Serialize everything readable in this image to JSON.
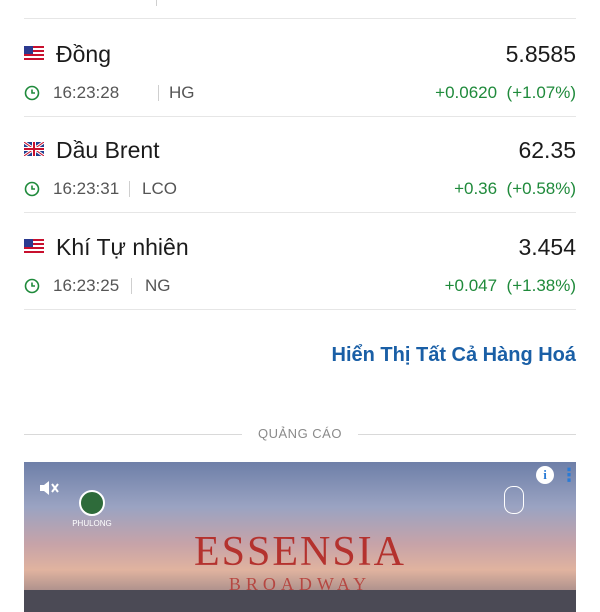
{
  "commodities": [
    {
      "name": "Đồng",
      "price": "5.8585",
      "time": "16:23:28",
      "symbol": "HG",
      "change": "+0.0620",
      "change_pct": "(+1.07%)",
      "flag": "us-flag-icon"
    },
    {
      "name": "Dầu Brent",
      "price": "62.35",
      "time": "16:23:31",
      "symbol": "LCO",
      "change": "+0.36",
      "change_pct": "(+0.58%)",
      "flag": "uk-flag-icon"
    },
    {
      "name": "Khí Tự nhiên",
      "price": "3.454",
      "time": "16:23:25",
      "symbol": "NG",
      "change": "+0.047",
      "change_pct": "(+1.38%)",
      "flag": "us-flag-icon"
    }
  ],
  "show_all_label": "Hiển Thị Tất Cả Hàng Hoá",
  "ad": {
    "label": "QUẢNG CÁO",
    "title": "ESSENSIA",
    "subtitle": "BROADWAY",
    "left_logo": "PHULONG"
  },
  "colors": {
    "positive": "#1f8a3b",
    "link": "#1a5fa6",
    "ad_title": "#b4322e"
  }
}
